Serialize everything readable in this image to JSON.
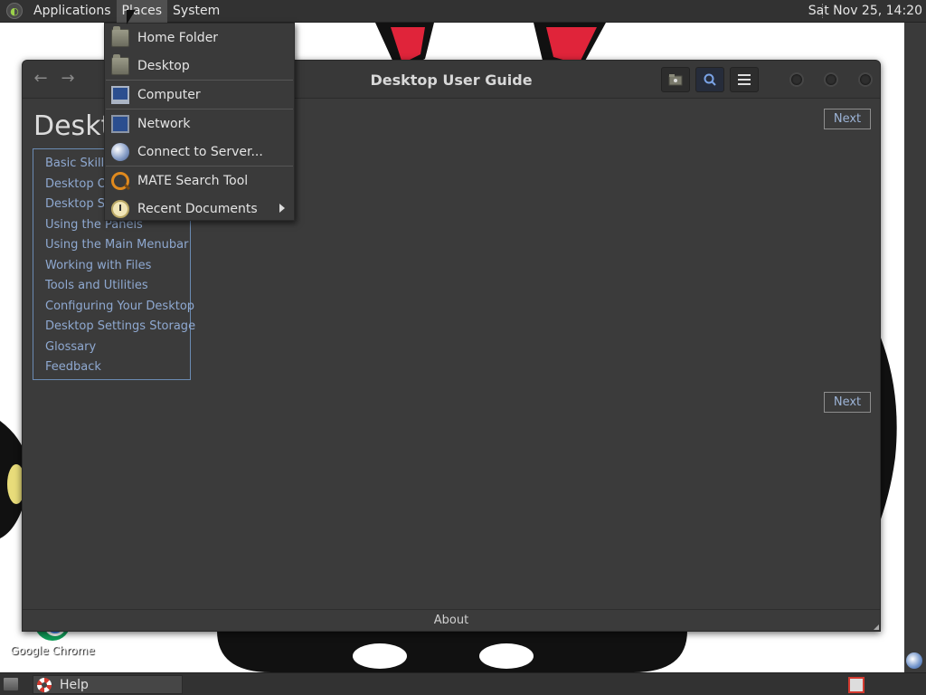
{
  "top_panel": {
    "menus": [
      "Applications",
      "Places",
      "System"
    ],
    "clock": "Sat Nov 25, 14:20"
  },
  "places_menu": {
    "items": [
      {
        "label": "Home Folder",
        "icon": "home-folder-icon"
      },
      {
        "label": "Desktop",
        "icon": "desktop-folder-icon"
      },
      {
        "label": "Computer",
        "icon": "computer-icon"
      },
      {
        "label": "Network",
        "icon": "network-icon"
      },
      {
        "label": "Connect to Server...",
        "icon": "globe-icon"
      },
      {
        "label": "MATE Search Tool",
        "icon": "search-tool-icon"
      },
      {
        "label": "Recent Documents",
        "icon": "recent-documents-icon",
        "submenu": true
      }
    ]
  },
  "help_window": {
    "title": "Desktop User Guide",
    "page_title_partial": "Deskt",
    "next_label": "Next",
    "toc": [
      "Basic Skills",
      "Desktop Ov",
      "Desktop Se",
      "Using the Panels",
      "Using the Main Menubar",
      "Working with Files",
      "Tools and Utilities",
      "Configuring Your Desktop",
      "Desktop Settings Storage",
      "Glossary",
      "Feedback"
    ],
    "footer": "About"
  },
  "desktop": {
    "icon_label": "Google Chrome"
  },
  "bottom_panel": {
    "task_label": "Help"
  },
  "colors": {
    "panel": "#323232",
    "window_bg": "#3b3b3b",
    "link": "#8fa9d1",
    "toc_border": "#6b8bb3"
  }
}
